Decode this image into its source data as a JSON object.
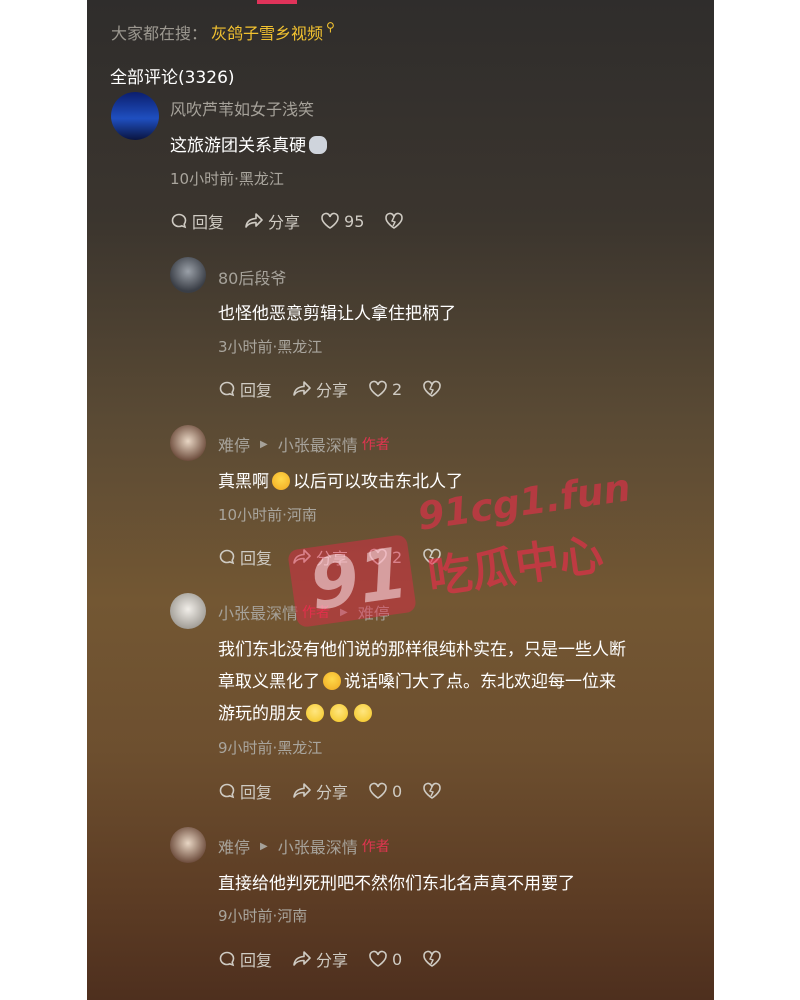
{
  "search": {
    "prefix": "大家都在搜：",
    "keyword": "灰鸽子雪乡视频",
    "icon": "search-icon"
  },
  "comments_header": "全部评论(3326)",
  "comments": [
    {
      "name": "风吹芦苇如女子浅笑",
      "body": "这旅游团关系真硬",
      "meta": "10小时前·黑龙江",
      "reply": "回复",
      "share": "分享",
      "likes": "95"
    },
    {
      "name": "80后段爷",
      "body": "也怪他恶意剪辑让人拿住把柄了",
      "meta": "3小时前·黑龙江",
      "reply": "回复",
      "share": "分享",
      "likes": "2"
    },
    {
      "name": "难停",
      "reply_to": "小张最深情",
      "body_a": "真黑啊",
      "body_b": "以后可以攻击东北人了",
      "meta": "10小时前·河南",
      "reply": "回复",
      "share": "分享",
      "likes": "2"
    },
    {
      "name": "小张最深情",
      "reply_to": "难停",
      "body_line1": "我们东北没有他们说的那样很纯朴实在，只是一些人断",
      "body_line2a": "章取义黑化了",
      "body_line2b": "说话嗓门大了点。东北欢迎每一位来",
      "body_line3": "游玩的朋友",
      "meta": "9小时前·黑龙江",
      "reply": "回复",
      "share": "分享",
      "likes": "0"
    },
    {
      "name": "难停",
      "reply_to": "小张最深情",
      "body": "直接给他判死刑吧不然你们东北名声真不用要了",
      "meta": "9小时前·河南",
      "reply": "回复",
      "share": "分享",
      "likes": "0"
    }
  ],
  "author_tag": "作者",
  "watermark": {
    "logo": "91",
    "url": "91cg1.fun",
    "brand": "吃瓜中心"
  },
  "colors": {
    "keyword": "#f2c230",
    "tag": "#e03550",
    "text": "#ffffff",
    "muted": "#a6a29a"
  }
}
